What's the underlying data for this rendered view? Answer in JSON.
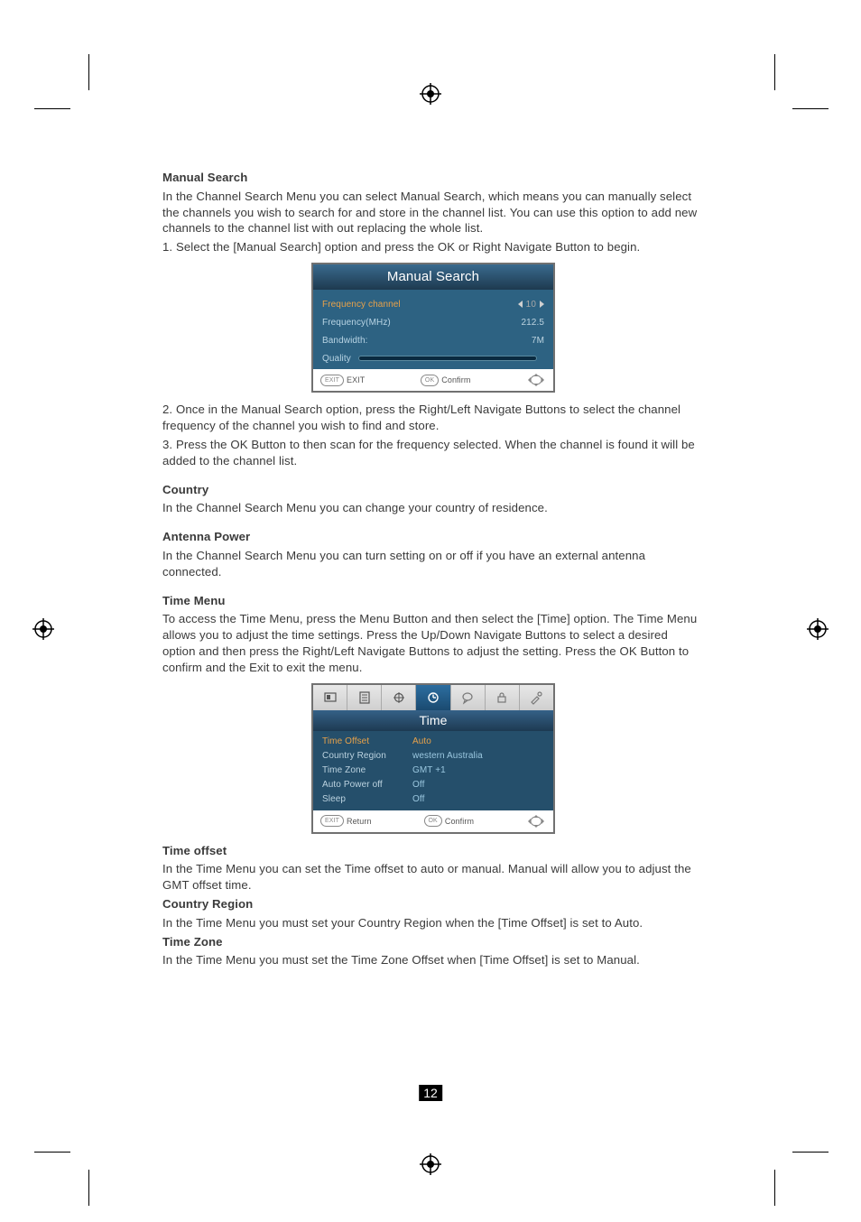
{
  "page_number": "12",
  "sections": {
    "manual_search": {
      "heading": "Manual Search",
      "p1": "In the Channel Search Menu you can select Manual Search, which means you can manually select the channels you wish to search for and store in the channel list.  You can use this option to add new channels to the channel list with out replacing the whole list.",
      "p2": "1. Select the [Manual Search] option and press the OK or Right Navigate Button to begin.",
      "p3": "2. Once in the Manual Search option, press the Right/Left Navigate Buttons to select the channel frequency of the channel you wish to find and store.",
      "p4": "3. Press the OK Button to then scan for the frequency selected. When the channel is found it will be added to the channel list."
    },
    "country": {
      "heading": "Country",
      "p1": "In the Channel Search Menu you can change your country of residence."
    },
    "antenna_power": {
      "heading": "Antenna Power",
      "p1": "In the Channel Search Menu you can turn setting on or off  if you have an external antenna connected."
    },
    "time_menu": {
      "heading": "Time Menu",
      "p1": "To access the Time Menu, press the Menu Button and then select the [Time] option. The Time Menu allows you to adjust the time settings. Press the Up/Down Navigate Buttons to select a desired option and then press the  Right/Left Navigate Buttons to adjust the setting. Press the OK Button to confirm and the Exit to exit the menu."
    },
    "time_offset": {
      "heading": "Time offset",
      "p1": "In the Time Menu you can set the Time offset to auto or manual. Manual will allow you to adjust the GMT offset time."
    },
    "country_region": {
      "heading": "Country Region",
      "p1": "In the Time Menu you must set your Country Region when the [Time Offset] is set to Auto."
    },
    "time_zone": {
      "heading": "Time Zone",
      "p1": "In the Time Menu you must set the Time Zone Offset when [Time Offset] is set to Manual."
    }
  },
  "fig_manual_search": {
    "title": "Manual Search",
    "rows": {
      "freq_channel": {
        "label": "Frequency channel",
        "value": "10"
      },
      "freq_mhz": {
        "label": "Frequency(MHz)",
        "value": "212.5"
      },
      "bandwidth": {
        "label": "Bandwidth:",
        "value": "7M"
      },
      "quality": {
        "label": "Quality"
      }
    },
    "footer": {
      "exit": "EXIT",
      "confirm": "Confirm"
    }
  },
  "fig_time": {
    "title": "Time",
    "rows": {
      "time_offset": {
        "label": "Time Offset",
        "value": "Auto"
      },
      "country_region": {
        "label": "Country Region",
        "value": "western Australia"
      },
      "time_zone": {
        "label": "Time Zone",
        "value": "GMT +1"
      },
      "auto_power_off": {
        "label": "Auto Power off",
        "value": "Off"
      },
      "sleep": {
        "label": "Sleep",
        "value": "Off"
      }
    },
    "footer": {
      "return": "Return",
      "confirm": "Confirm"
    }
  },
  "icons": {
    "reg_mark": "registration-mark",
    "tabs": [
      "picture-icon",
      "channel-icon",
      "search-icon",
      "time-icon",
      "language-icon",
      "lock-icon",
      "setup-icon"
    ]
  }
}
